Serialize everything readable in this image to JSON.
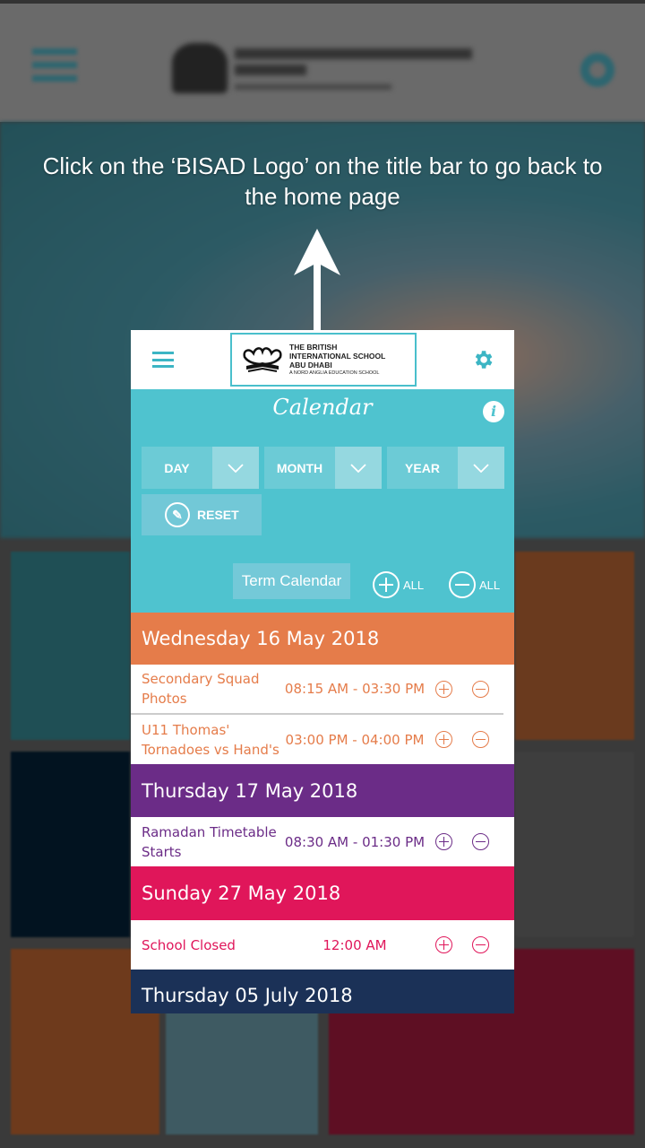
{
  "instruction": "Click on the ‘BISAD Logo’ on the title bar to go back to the home page",
  "app": {
    "logo": {
      "line1": "THE BRITISH",
      "line2": "INTERNATIONAL SCHOOL",
      "line3": "ABU DHABI",
      "tagline": "A NORD ANGLIA EDUCATION SCHOOL"
    },
    "menu_icon": "hamburger-icon",
    "settings_icon": "gear-icon"
  },
  "calendar": {
    "title": "Calendar",
    "info_label": "i",
    "filters": [
      {
        "label": "DAY"
      },
      {
        "label": "MONTH"
      },
      {
        "label": "YEAR"
      }
    ],
    "reset_label": "RESET",
    "term_calendar_label": "Term Calendar",
    "expand_all_label": "ALL",
    "collapse_all_label": "ALL",
    "days": [
      {
        "date": "Wednesday 16 May 2018",
        "color": "#e57c4a",
        "events": [
          {
            "name": "Secondary Squad Photos",
            "time": "08:15 AM - 03:30 PM"
          },
          {
            "name": "U11 Thomas' Tornadoes vs Hand's",
            "time": "03:00 PM - 04:00 PM"
          }
        ]
      },
      {
        "date": "Thursday 17 May 2018",
        "color": "#6b2c87",
        "events": [
          {
            "name": "Ramadan Timetable Starts",
            "time": "08:30 AM - 01:30 PM"
          }
        ]
      },
      {
        "date": "Sunday 27 May 2018",
        "color": "#e0165a",
        "events": [
          {
            "name": "School Closed",
            "time": "12:00 AM"
          }
        ]
      },
      {
        "date": "Thursday 05 July 2018",
        "color": "#1b3157",
        "events": []
      }
    ]
  },
  "colors": {
    "teal": "#4fc3cf",
    "orange": "#e57c4a",
    "purple": "#6b2c87",
    "pink": "#e0165a",
    "navy": "#1b3157"
  }
}
